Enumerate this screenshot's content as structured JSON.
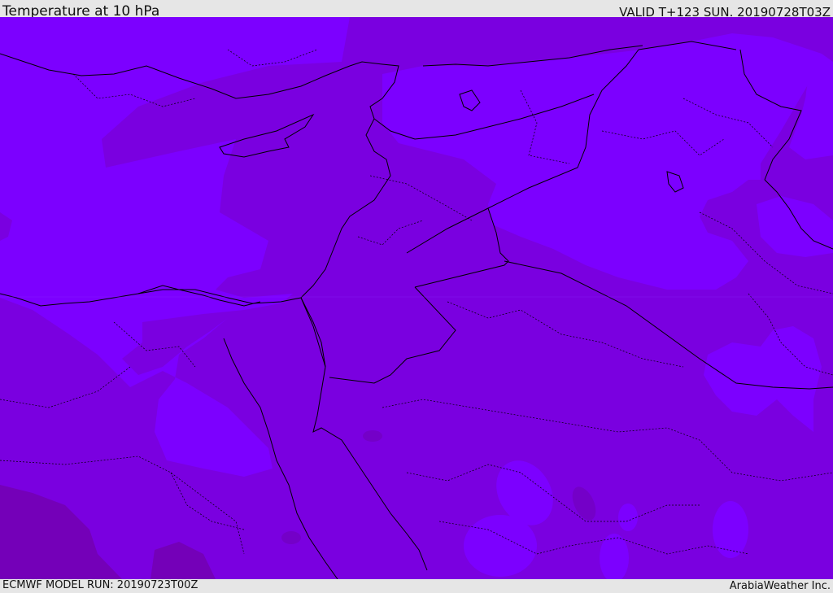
{
  "header": {
    "title": "Temperature at 10 hPa",
    "valid_time": "VALID T+123 SUN. 20190728T03Z"
  },
  "map": {
    "colors": {
      "warm_region": "#7a00e0",
      "cool_region": "#7c00ff",
      "coldest_patch": "#7400a8",
      "coastline": "#000000",
      "border": "#000000"
    }
  },
  "footer": {
    "model_run": "ECMWF MODEL RUN: 20190723T00Z",
    "provider": "ArabiaWeather Inc."
  }
}
